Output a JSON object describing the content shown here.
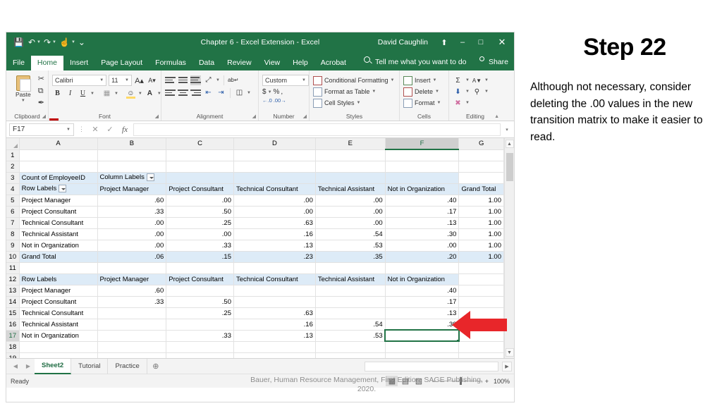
{
  "window": {
    "title": "Chapter 6 - Excel Extension  -  Excel",
    "user": "David Caughlin",
    "qat": [
      {
        "name": "save-icon",
        "glyph": "⬚"
      },
      {
        "name": "undo-icon",
        "glyph": "↶"
      },
      {
        "name": "redo-icon",
        "glyph": "↷"
      },
      {
        "name": "touch-mode-icon",
        "glyph": "☝"
      },
      {
        "name": "customize-qat-icon",
        "glyph": "⌵"
      }
    ],
    "controls": {
      "ribbon_display": "⬆",
      "minimize": "–",
      "restore": "□",
      "close": "✕"
    }
  },
  "ribbon_tabs": [
    {
      "label": "File",
      "active": false
    },
    {
      "label": "Home",
      "active": true
    },
    {
      "label": "Insert",
      "active": false
    },
    {
      "label": "Page Layout",
      "active": false
    },
    {
      "label": "Formulas",
      "active": false
    },
    {
      "label": "Data",
      "active": false
    },
    {
      "label": "Review",
      "active": false
    },
    {
      "label": "View",
      "active": false
    },
    {
      "label": "Help",
      "active": false
    },
    {
      "label": "Acrobat",
      "active": false
    }
  ],
  "tell_me": "Tell me what you want to do",
  "share": "Share",
  "ribbon": {
    "clipboard": {
      "label": "Clipboard",
      "paste": "Paste",
      "cut": "✂",
      "copy": "⧉",
      "format_painter": "🖌"
    },
    "font": {
      "label": "Font",
      "font_name": "Calibri",
      "font_size": "11",
      "grow_font": "A",
      "shrink_font": "A",
      "bold": "B",
      "italic": "I",
      "underline": "U",
      "borders": "⊞",
      "fill_color": "A",
      "font_color": "A"
    },
    "alignment": {
      "label": "Alignment",
      "orientation": "⌫",
      "wrap_text": "ab",
      "merge_center": "⌷"
    },
    "number": {
      "label": "Number",
      "format": "Custom",
      "currency": "$",
      "percent": "%",
      "comma": ",",
      "increase_decimal": ".00",
      "decrease_decimal": ".00"
    },
    "styles": {
      "label": "Styles",
      "conditional_formatting": "Conditional Formatting",
      "format_as_table": "Format as Table",
      "cell_styles": "Cell Styles"
    },
    "cells": {
      "label": "Cells",
      "insert": "Insert",
      "delete": "Delete",
      "format": "Format"
    },
    "editing": {
      "label": "Editing",
      "autosum": "Σ",
      "fill": "⬇",
      "clear": "⌫",
      "sort_filter": "A↓",
      "find_select": "⚲",
      "collapse": "⌃"
    }
  },
  "formula_bar": {
    "name_box": "F17",
    "cancel": "✕",
    "enter": "✓",
    "insert_function": "fx",
    "value": "",
    "expand": "⌄"
  },
  "grid": {
    "columns": [
      "A",
      "B",
      "C",
      "D",
      "E",
      "F",
      "G"
    ],
    "selected_column": "F",
    "selected_cell": "F17",
    "rows": [
      {
        "n": "1",
        "cells": [
          "",
          "",
          "",
          "",
          "",
          "",
          ""
        ]
      },
      {
        "n": "2",
        "cells": [
          "",
          "",
          "",
          "",
          "",
          "",
          ""
        ]
      },
      {
        "n": "3",
        "cells": [
          "Count of EmployeeID",
          "Column Labels",
          "",
          "",
          "",
          "",
          ""
        ],
        "style": "pivot-header-top"
      },
      {
        "n": "4",
        "cells": [
          "Row Labels",
          "Project Manager",
          "Project Consultant",
          "Technical Consultant",
          "Technical Assistant",
          "Not in Organization",
          "Grand Total"
        ],
        "style": "pivot-header"
      },
      {
        "n": "5",
        "cells": [
          "Project Manager",
          ".60",
          ".00",
          ".00",
          ".00",
          ".40",
          "1.00"
        ]
      },
      {
        "n": "6",
        "cells": [
          "Project Consultant",
          ".33",
          ".50",
          ".00",
          ".00",
          ".17",
          "1.00"
        ]
      },
      {
        "n": "7",
        "cells": [
          "Technical Consultant",
          ".00",
          ".25",
          ".63",
          ".00",
          ".13",
          "1.00"
        ]
      },
      {
        "n": "8",
        "cells": [
          "Technical Assistant",
          ".00",
          ".00",
          ".16",
          ".54",
          ".30",
          "1.00"
        ]
      },
      {
        "n": "9",
        "cells": [
          "Not in Organization",
          ".00",
          ".33",
          ".13",
          ".53",
          ".00",
          "1.00"
        ]
      },
      {
        "n": "10",
        "cells": [
          "Grand Total",
          ".06",
          ".15",
          ".23",
          ".35",
          ".20",
          "1.00"
        ],
        "style": "pivot-total"
      },
      {
        "n": "11",
        "cells": [
          "",
          "",
          "",
          "",
          "",
          "",
          ""
        ]
      },
      {
        "n": "12",
        "cells": [
          "Row Labels",
          "Project Manager",
          "Project Consultant",
          "Technical Consultant",
          "Technical Assistant",
          "Not in Organization",
          ""
        ],
        "style": "pivot-header"
      },
      {
        "n": "13",
        "cells": [
          "Project Manager",
          ".60",
          "",
          "",
          "",
          ".40",
          ""
        ]
      },
      {
        "n": "14",
        "cells": [
          "Project Consultant",
          ".33",
          ".50",
          "",
          "",
          ".17",
          ""
        ]
      },
      {
        "n": "15",
        "cells": [
          "Technical Consultant",
          "",
          ".25",
          ".63",
          "",
          ".13",
          ""
        ]
      },
      {
        "n": "16",
        "cells": [
          "Technical Assistant",
          "",
          "",
          ".16",
          ".54",
          ".30",
          ""
        ]
      },
      {
        "n": "17",
        "cells": [
          "Not in Organization",
          "",
          ".33",
          ".13",
          ".53",
          "",
          ""
        ],
        "selected_index": 5
      },
      {
        "n": "18",
        "cells": [
          "",
          "",
          "",
          "",
          "",
          "",
          ""
        ]
      },
      {
        "n": "19",
        "cells": [
          "",
          "",
          "",
          "",
          "",
          "",
          ""
        ]
      }
    ]
  },
  "sheet_tabs": {
    "prev": "◀",
    "next": "▶",
    "tabs": [
      {
        "label": "Sheet2",
        "active": true
      },
      {
        "label": "Tutorial",
        "active": false
      },
      {
        "label": "Practice",
        "active": false
      }
    ],
    "add": "⊕",
    "scroll_right": "▶"
  },
  "status_bar": {
    "status": "Ready",
    "views": [
      {
        "name": "normal-view-icon",
        "glyph": "▦",
        "active": true
      },
      {
        "name": "page-layout-view-icon",
        "glyph": "▤",
        "active": false
      },
      {
        "name": "page-break-view-icon",
        "glyph": "▧",
        "active": false
      }
    ],
    "zoom_out": "−",
    "zoom_in": "+",
    "zoom_level": "100%"
  },
  "citation": "Bauer, Human Resource Management, First Edition. SAGE Publishing, 2020.",
  "annotation": {
    "arrow_name": "red-left-arrow",
    "arrow_color": "#e8262a",
    "points_to_row": "15"
  },
  "panel": {
    "title": "Step 22",
    "body": "Although not necessary, consider deleting the .00 values in the new transition matrix to make it easier to read."
  }
}
